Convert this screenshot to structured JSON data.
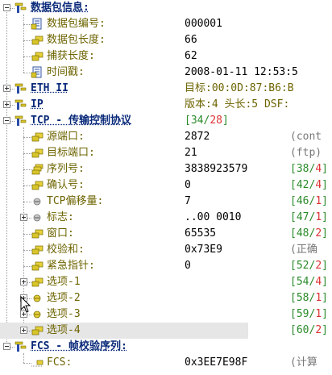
{
  "window": {
    "title": "数据包信息"
  },
  "tree": [
    {
      "name": "packet-info-header",
      "label": "数据包信息:",
      "header": true,
      "expanded": true,
      "icon": "protocol-header-icon"
    },
    {
      "name": "packet-number",
      "label": "数据包编号:",
      "value": "000001",
      "icon": "doc-field-icon"
    },
    {
      "name": "packet-length",
      "label": "数据包长度:",
      "value": "66",
      "icon": "field-icon"
    },
    {
      "name": "capture-length",
      "label": "捕获长度:",
      "value": "62",
      "icon": "field-icon"
    },
    {
      "name": "timestamp",
      "label": "时间戳:",
      "value": "2008-01-11 12:53:5",
      "icon": "doc-field-icon"
    },
    {
      "name": "eth-ii-header",
      "label": "ETH II",
      "header": true,
      "expanded": false,
      "icon": "protocol-header-icon",
      "value": "目标:00:0D:87:B6:B",
      "value_cn": true
    },
    {
      "name": "ip-header",
      "label": "IP",
      "header": true,
      "expanded": false,
      "icon": "protocol-header-icon",
      "value": "版本:4 头长:5 DSF:",
      "value_cn": true
    },
    {
      "name": "tcp-header",
      "label": "TCP - 传输控制协议",
      "header": true,
      "expanded": true,
      "icon": "protocol-header-icon",
      "bracket": [
        "34",
        "28"
      ]
    },
    {
      "name": "source-port",
      "label": "源端口:",
      "value": "2872",
      "icon": "field-icon",
      "extra": "(cont"
    },
    {
      "name": "dest-port",
      "label": "目标端口:",
      "value": "21",
      "icon": "field-icon",
      "extra": "(ftp)"
    },
    {
      "name": "sequence-number",
      "label": "序列号:",
      "value": "3838923579",
      "icon": "multi-field-icon",
      "bracket": [
        "38",
        "4"
      ]
    },
    {
      "name": "ack-number",
      "label": "确认号:",
      "value": "0",
      "icon": "field-icon",
      "bracket": [
        "42",
        "4"
      ]
    },
    {
      "name": "tcp-offset",
      "label": "TCP偏移量:",
      "value": "7",
      "icon": "circle-field-icon",
      "bracket": [
        "46",
        "1"
      ]
    },
    {
      "name": "flags",
      "label": "标志:",
      "value": "..00 0010",
      "icon": "circle-field-icon",
      "expanded": false,
      "bracket": [
        "47",
        "1"
      ]
    },
    {
      "name": "window",
      "label": "窗口:",
      "value": "65535",
      "icon": "field-icon",
      "bracket": [
        "48",
        "2"
      ]
    },
    {
      "name": "checksum",
      "label": "校验和:",
      "value": "0x73E9",
      "icon": "field-icon",
      "extra": "(正确"
    },
    {
      "name": "urgent-pointer",
      "label": "紧急指针:",
      "value": "0",
      "icon": "field-icon",
      "bracket": [
        "52",
        "2"
      ]
    },
    {
      "name": "option-1",
      "label": "选项-1",
      "icon": "field-icon",
      "expanded": false,
      "bracket": [
        "54",
        "4"
      ]
    },
    {
      "name": "option-2",
      "label": "选项-2",
      "icon": "circle-yellow-icon",
      "expanded": false,
      "bracket": [
        "58",
        "1"
      ]
    },
    {
      "name": "option-3",
      "label": "选项-3",
      "icon": "circle-yellow-icon",
      "expanded": false,
      "bracket": [
        "59",
        "1"
      ]
    },
    {
      "name": "option-4",
      "label": "选项-4",
      "icon": "field-icon",
      "expanded": false,
      "bracket": [
        "60",
        "2"
      ],
      "selected": true
    },
    {
      "name": "fcs-header",
      "label": "FCS - 帧校验序列:",
      "header": true,
      "expanded": true,
      "icon": "protocol-header-icon"
    },
    {
      "name": "fcs-value",
      "label": "FCS:",
      "value": "0x3EE7E98F",
      "icon": "dotted-field-icon",
      "extra": "(计算"
    }
  ]
}
